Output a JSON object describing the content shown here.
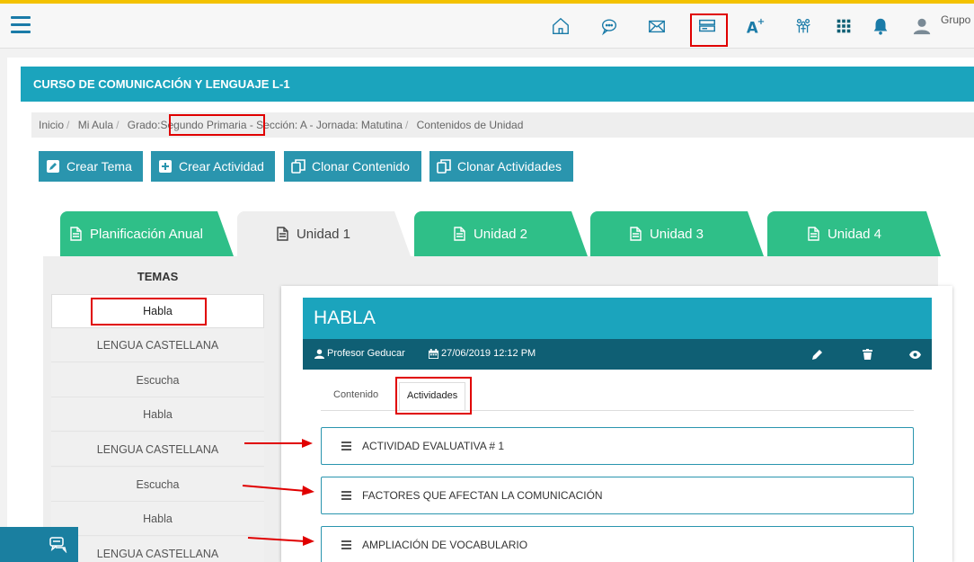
{
  "topbar": {
    "user_label": "Grupo",
    "icons": [
      "home-icon",
      "chat-icon",
      "mail-icon",
      "cards-icon",
      "font-plus-icon",
      "people-icon",
      "apps-grid-icon",
      "bell-icon",
      "user-avatar-icon"
    ],
    "accent_color": "#1a7ba8",
    "stripe_color": "#f3c200"
  },
  "course": {
    "title": "CURSO DE COMUNICACIÓN Y LENGUAJE L-1",
    "header_color": "#1ba4bd"
  },
  "breadcrumb": {
    "inicio": "Inicio",
    "mi_aula": "Mi Aula",
    "grado_prefix": "Grado:",
    "grado": "Segundo Primaria",
    "rest": "- Sección: A - Jornada: Matutina",
    "current": "Contenidos de Unidad"
  },
  "actions": {
    "crear_tema": "Crear Tema",
    "crear_actividad": "Crear Actividad",
    "clonar_contenido": "Clonar Contenido",
    "clonar_actividades": "Clonar Actividades"
  },
  "tabs": [
    {
      "label": "Planificación Anual"
    },
    {
      "label": "Unidad 1"
    },
    {
      "label": "Unidad 2"
    },
    {
      "label": "Unidad 3"
    },
    {
      "label": "Unidad 4"
    }
  ],
  "temas": {
    "title": "TEMAS",
    "items": [
      "Habla",
      "LENGUA CASTELLANA",
      "Escucha",
      "Habla",
      "LENGUA CASTELLANA",
      "Escucha",
      "Habla",
      "LENGUA CASTELLANA"
    ]
  },
  "content": {
    "title": "HABLA",
    "author": "Profesor Geducar",
    "date": "27/06/2019 12:12 PM",
    "subtabs": [
      "Contenido",
      "Actividades"
    ],
    "activities": [
      "ACTIVIDAD EVALUATIVA # 1",
      "FACTORES QUE AFECTAN LA COMUNICACIÓN",
      "AMPLIACIÓN DE VOCABULARIO"
    ]
  }
}
